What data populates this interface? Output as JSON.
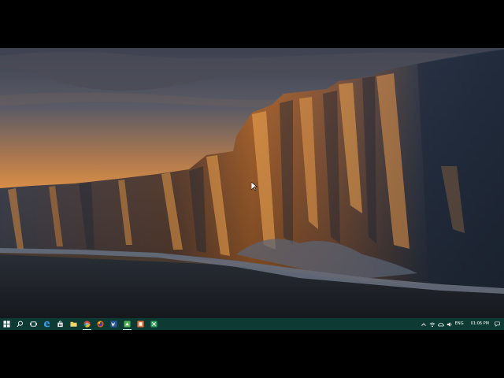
{
  "desktop": {
    "wallpaper": "antarctic-ice-shelf-sunset"
  },
  "taskbar": {
    "background": "#0d3b33",
    "foreground": "#ffffff",
    "pinned": [
      {
        "name": "start",
        "icon": "windows-logo-icon",
        "active": false
      },
      {
        "name": "search",
        "icon": "search-icon",
        "active": false
      },
      {
        "name": "task-view",
        "icon": "task-view-icon",
        "active": false
      },
      {
        "name": "edge",
        "icon": "edge-icon",
        "active": false
      },
      {
        "name": "store",
        "icon": "store-icon",
        "active": false
      },
      {
        "name": "file-explorer",
        "icon": "folder-icon",
        "active": false
      },
      {
        "name": "chrome",
        "icon": "chrome-icon",
        "active": true
      },
      {
        "name": "firefox",
        "icon": "firefox-icon",
        "active": false
      },
      {
        "name": "word",
        "icon": "word-icon",
        "active": false
      },
      {
        "name": "app-green",
        "icon": "green-app-icon",
        "active": true
      },
      {
        "name": "app-orange",
        "icon": "orange-app-icon",
        "active": false
      },
      {
        "name": "app-green-2",
        "icon": "green-app-2-icon",
        "active": false
      }
    ],
    "tray": {
      "language": "ENG",
      "time": "01:06 PM"
    }
  }
}
